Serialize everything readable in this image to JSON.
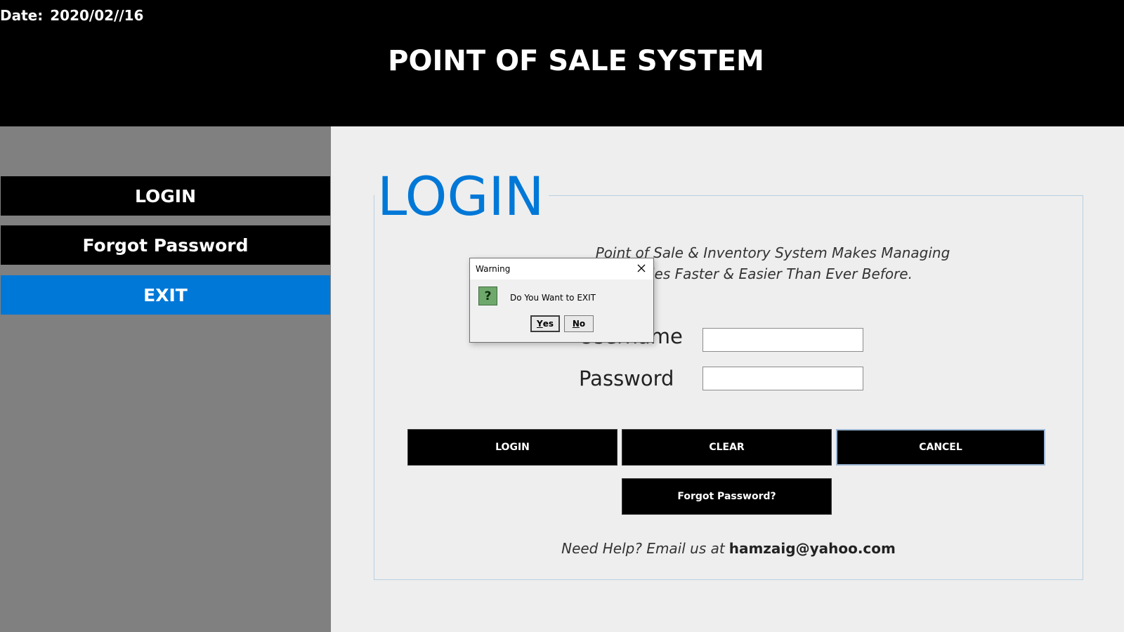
{
  "header": {
    "date_label": "Date:",
    "date_value": "2020/02//16",
    "title": "POINT OF SALE SYSTEM"
  },
  "sidebar": {
    "items": [
      {
        "label": "LOGIN"
      },
      {
        "label": "Forgot Password"
      },
      {
        "label": "EXIT",
        "active": true
      }
    ],
    "active_color": "#0078d7"
  },
  "login": {
    "heading": "LOGIN",
    "description_line1": "Point of Sale & Inventory System Makes Managing",
    "description_line2": "Sales Faster & Easier Than Ever Before.",
    "username_label": "Username",
    "password_label": "Password",
    "username_value": "",
    "password_value": "",
    "buttons": {
      "login": "LOGIN",
      "clear": "CLEAR",
      "cancel": "CANCEL",
      "forgot": "Forgot Password?"
    },
    "help_text": "Need Help? Email us at",
    "help_email": "hamzaig@yahoo.com"
  },
  "dialog": {
    "title": "Warning",
    "icon": "question-icon",
    "icon_glyph": "?",
    "message": "Do You Want to EXIT",
    "yes_mnemonic": "Y",
    "yes_rest": "es",
    "no_mnemonic": "N",
    "no_rest": "o"
  },
  "colors": {
    "accent": "#0078d7",
    "header_bg": "#000000",
    "sidebar_bg": "#808080",
    "content_bg": "#eeeeee"
  }
}
